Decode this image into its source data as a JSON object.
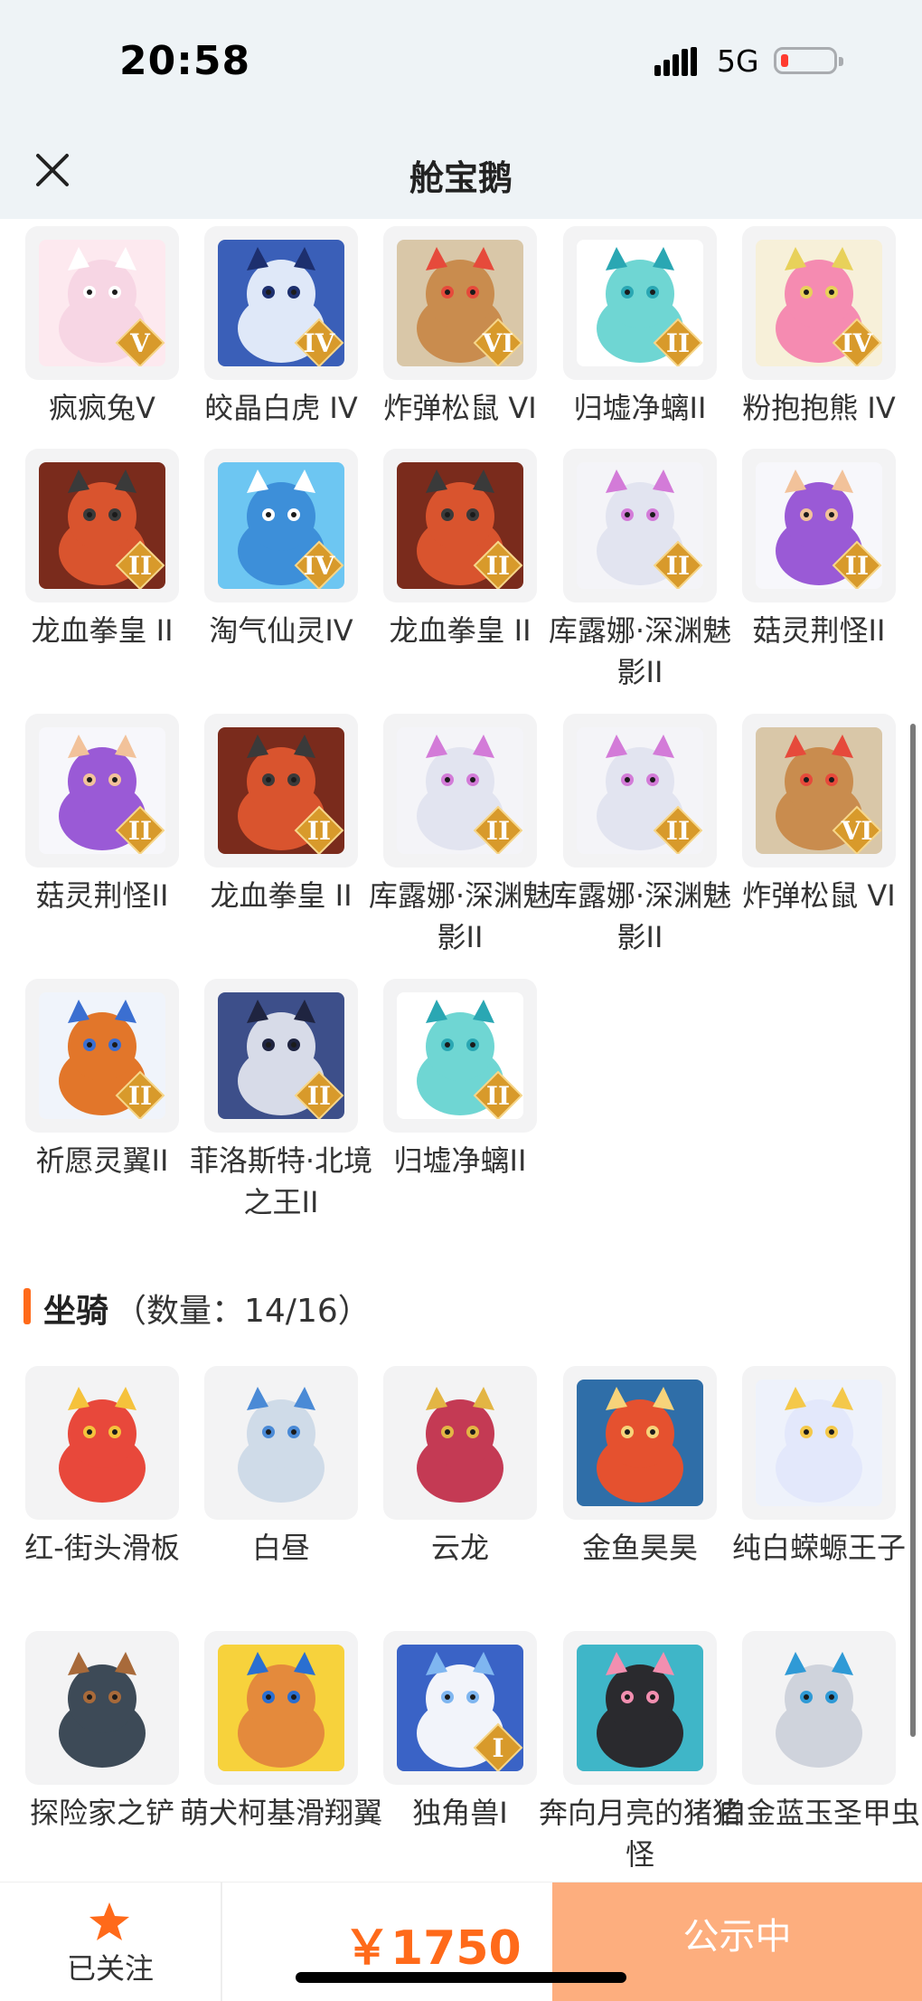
{
  "status_bar": {
    "time": "20:58",
    "network": "5G"
  },
  "header": {
    "title": "舱宝鹅"
  },
  "pets_grid": [
    {
      "name": "疯疯兔V",
      "badge": "V",
      "bg": "#fde9ef",
      "body": "#f7d6e4",
      "accent": "#ffffff",
      "icon": "rabbit-icon"
    },
    {
      "name": "皎晶白虎 IV",
      "badge": "IV",
      "bg": "#3a5fb8",
      "body": "#dfe8f8",
      "accent": "#1d2f6e",
      "icon": "tiger-icon"
    },
    {
      "name": "炸弹松鼠 VI",
      "badge": "VI",
      "bg": "#d9c7a8",
      "body": "#c98c4e",
      "accent": "#e64a3b",
      "icon": "squirrel-icon"
    },
    {
      "name": "归墟净螭II",
      "badge": "II",
      "bg": "#ffffff",
      "body": "#6fd6d3",
      "accent": "#2aa7b3",
      "icon": "dragon-icon"
    },
    {
      "name": "粉抱抱熊 IV",
      "badge": "IV",
      "bg": "#f7f0d9",
      "body": "#f58bb1",
      "accent": "#e8d15a",
      "icon": "bear-icon"
    },
    {
      "name": "龙血拳皇 II",
      "badge": "II",
      "bg": "#7a2b1c",
      "body": "#d9542e",
      "accent": "#3a3a3a",
      "icon": "beast-icon"
    },
    {
      "name": "淘气仙灵IV",
      "badge": "IV",
      "bg": "#6dc6f2",
      "body": "#3d8fd9",
      "accent": "#ffffff",
      "icon": "sprite-icon"
    },
    {
      "name": "龙血拳皇 II",
      "badge": "II",
      "bg": "#7a2b1c",
      "body": "#d9542e",
      "accent": "#3a3a3a",
      "icon": "beast-icon"
    },
    {
      "name": "库露娜·深渊魅影II",
      "badge": "II",
      "bg": "#f4f4f8",
      "body": "#e2e4f0",
      "accent": "#d37bd8",
      "icon": "phantom-icon"
    },
    {
      "name": "菇灵荆怪II",
      "badge": "II",
      "bg": "#f7f7fb",
      "body": "#9a5ad6",
      "accent": "#f2c29a",
      "icon": "mushroom-icon"
    },
    {
      "name": "菇灵荆怪II",
      "badge": "II",
      "bg": "#f7f7fb",
      "body": "#9a5ad6",
      "accent": "#f2c29a",
      "icon": "mushroom-icon"
    },
    {
      "name": "龙血拳皇 II",
      "badge": "II",
      "bg": "#7a2b1c",
      "body": "#d9542e",
      "accent": "#3a3a3a",
      "icon": "beast-icon"
    },
    {
      "name": "库露娜·深渊魅影II",
      "badge": "II",
      "bg": "#f4f4f8",
      "body": "#e2e4f0",
      "accent": "#d37bd8",
      "icon": "phantom-icon"
    },
    {
      "name": "库露娜·深渊魅影II",
      "badge": "II",
      "bg": "#f4f4f8",
      "body": "#e2e4f0",
      "accent": "#d37bd8",
      "icon": "phantom-icon"
    },
    {
      "name": "炸弹松鼠 VI",
      "badge": "VI",
      "bg": "#d9c7a8",
      "body": "#c98c4e",
      "accent": "#e64a3b",
      "icon": "squirrel-icon"
    },
    {
      "name": "祈愿灵翼II",
      "badge": "II",
      "bg": "#f0f4fb",
      "body": "#e2762a",
      "accent": "#3b6fd1",
      "icon": "bird-icon"
    },
    {
      "name": "菲洛斯特·北境之王II",
      "badge": "II",
      "bg": "#3d4f8a",
      "body": "#d7dbe8",
      "accent": "#1f2440",
      "icon": "frost-king-icon"
    },
    {
      "name": "归墟净螭II",
      "badge": "II",
      "bg": "#ffffff",
      "body": "#6fd6d3",
      "accent": "#2aa7b3",
      "icon": "dragon-icon"
    }
  ],
  "mounts_section": {
    "title": "坐骑",
    "count_text": "（数量：14/16）"
  },
  "mounts_grid": [
    {
      "name": "红-街头滑板",
      "badge": "",
      "bg": "#f3f3f4",
      "body": "#e8483b",
      "accent": "#f5c23c",
      "icon": "skateboard-icon"
    },
    {
      "name": "白昼",
      "badge": "",
      "bg": "#f3f3f4",
      "body": "#cfdbe8",
      "accent": "#4a8ad6",
      "icon": "white-beast-icon"
    },
    {
      "name": "云龙",
      "badge": "",
      "bg": "#f3f3f4",
      "body": "#c43a54",
      "accent": "#e3b544",
      "icon": "cloud-dragon-icon"
    },
    {
      "name": "金鱼昊昊",
      "badge": "",
      "bg": "#2f6ea8",
      "body": "#e5512f",
      "accent": "#f7d37a",
      "icon": "goldfish-icon"
    },
    {
      "name": "纯白蝾螈王子",
      "badge": "",
      "bg": "#eef2fb",
      "body": "#e3e8fb",
      "accent": "#f4c84a",
      "icon": "axolotl-icon"
    },
    {
      "name": "探险家之铲",
      "badge": "",
      "bg": "#f3f3f4",
      "body": "#3d4a57",
      "accent": "#a86a3a",
      "icon": "shovel-icon"
    },
    {
      "name": "萌犬柯基滑翔翼",
      "badge": "",
      "bg": "#f7d23c",
      "body": "#e48a3c",
      "accent": "#2a6fd1",
      "icon": "corgi-icon"
    },
    {
      "name": "独角兽I",
      "badge": "I",
      "bg": "#3a63c6",
      "body": "#f2f4fa",
      "accent": "#7fb6f0",
      "icon": "unicorn-icon"
    },
    {
      "name": "奔向月亮的猪猪怪",
      "badge": "",
      "bg": "#3fb6c8",
      "body": "#2a2a2e",
      "accent": "#f28fb0",
      "icon": "pig-icon"
    },
    {
      "name": "白金蓝玉圣甲虫",
      "badge": "",
      "bg": "#f3f3f4",
      "body": "#cfd3dc",
      "accent": "#2f9ad6",
      "icon": "beetle-icon"
    }
  ],
  "bottom_bar": {
    "follow_label": "已关注",
    "price": "￥1750",
    "status_button": "公示中"
  },
  "colors": {
    "accent": "#ff6a1a",
    "status_button_bg": "#fdae7e",
    "header_bg": "#eef3f6"
  }
}
